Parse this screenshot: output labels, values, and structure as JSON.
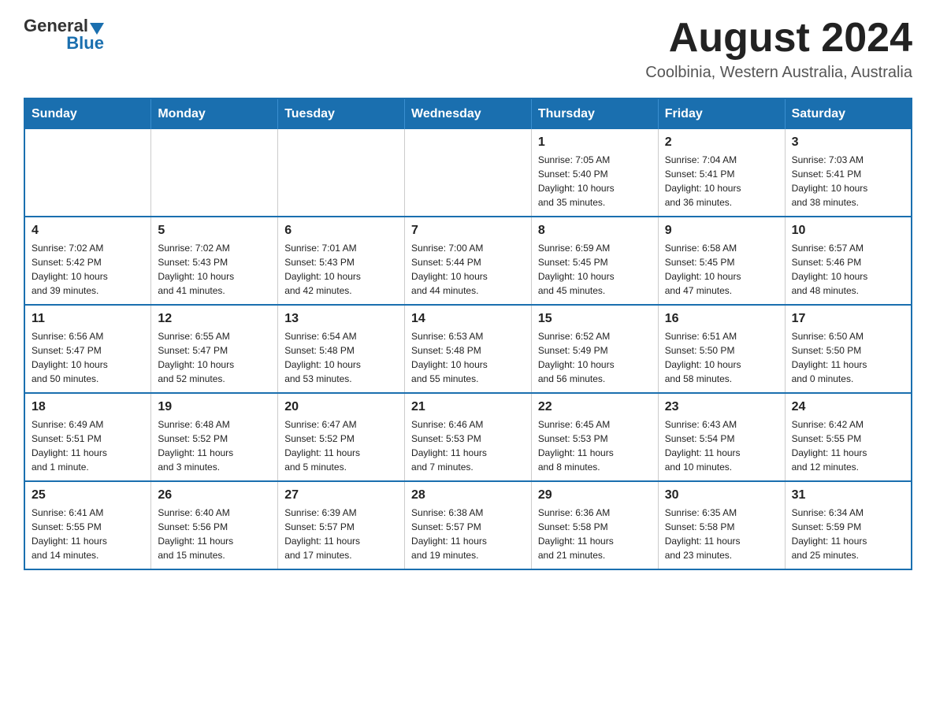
{
  "header": {
    "logo_general": "General",
    "logo_blue": "Blue",
    "month_title": "August 2024",
    "location": "Coolbinia, Western Australia, Australia"
  },
  "weekdays": [
    "Sunday",
    "Monday",
    "Tuesday",
    "Wednesday",
    "Thursday",
    "Friday",
    "Saturday"
  ],
  "weeks": [
    [
      {
        "day": "",
        "info": ""
      },
      {
        "day": "",
        "info": ""
      },
      {
        "day": "",
        "info": ""
      },
      {
        "day": "",
        "info": ""
      },
      {
        "day": "1",
        "info": "Sunrise: 7:05 AM\nSunset: 5:40 PM\nDaylight: 10 hours\nand 35 minutes."
      },
      {
        "day": "2",
        "info": "Sunrise: 7:04 AM\nSunset: 5:41 PM\nDaylight: 10 hours\nand 36 minutes."
      },
      {
        "day": "3",
        "info": "Sunrise: 7:03 AM\nSunset: 5:41 PM\nDaylight: 10 hours\nand 38 minutes."
      }
    ],
    [
      {
        "day": "4",
        "info": "Sunrise: 7:02 AM\nSunset: 5:42 PM\nDaylight: 10 hours\nand 39 minutes."
      },
      {
        "day": "5",
        "info": "Sunrise: 7:02 AM\nSunset: 5:43 PM\nDaylight: 10 hours\nand 41 minutes."
      },
      {
        "day": "6",
        "info": "Sunrise: 7:01 AM\nSunset: 5:43 PM\nDaylight: 10 hours\nand 42 minutes."
      },
      {
        "day": "7",
        "info": "Sunrise: 7:00 AM\nSunset: 5:44 PM\nDaylight: 10 hours\nand 44 minutes."
      },
      {
        "day": "8",
        "info": "Sunrise: 6:59 AM\nSunset: 5:45 PM\nDaylight: 10 hours\nand 45 minutes."
      },
      {
        "day": "9",
        "info": "Sunrise: 6:58 AM\nSunset: 5:45 PM\nDaylight: 10 hours\nand 47 minutes."
      },
      {
        "day": "10",
        "info": "Sunrise: 6:57 AM\nSunset: 5:46 PM\nDaylight: 10 hours\nand 48 minutes."
      }
    ],
    [
      {
        "day": "11",
        "info": "Sunrise: 6:56 AM\nSunset: 5:47 PM\nDaylight: 10 hours\nand 50 minutes."
      },
      {
        "day": "12",
        "info": "Sunrise: 6:55 AM\nSunset: 5:47 PM\nDaylight: 10 hours\nand 52 minutes."
      },
      {
        "day": "13",
        "info": "Sunrise: 6:54 AM\nSunset: 5:48 PM\nDaylight: 10 hours\nand 53 minutes."
      },
      {
        "day": "14",
        "info": "Sunrise: 6:53 AM\nSunset: 5:48 PM\nDaylight: 10 hours\nand 55 minutes."
      },
      {
        "day": "15",
        "info": "Sunrise: 6:52 AM\nSunset: 5:49 PM\nDaylight: 10 hours\nand 56 minutes."
      },
      {
        "day": "16",
        "info": "Sunrise: 6:51 AM\nSunset: 5:50 PM\nDaylight: 10 hours\nand 58 minutes."
      },
      {
        "day": "17",
        "info": "Sunrise: 6:50 AM\nSunset: 5:50 PM\nDaylight: 11 hours\nand 0 minutes."
      }
    ],
    [
      {
        "day": "18",
        "info": "Sunrise: 6:49 AM\nSunset: 5:51 PM\nDaylight: 11 hours\nand 1 minute."
      },
      {
        "day": "19",
        "info": "Sunrise: 6:48 AM\nSunset: 5:52 PM\nDaylight: 11 hours\nand 3 minutes."
      },
      {
        "day": "20",
        "info": "Sunrise: 6:47 AM\nSunset: 5:52 PM\nDaylight: 11 hours\nand 5 minutes."
      },
      {
        "day": "21",
        "info": "Sunrise: 6:46 AM\nSunset: 5:53 PM\nDaylight: 11 hours\nand 7 minutes."
      },
      {
        "day": "22",
        "info": "Sunrise: 6:45 AM\nSunset: 5:53 PM\nDaylight: 11 hours\nand 8 minutes."
      },
      {
        "day": "23",
        "info": "Sunrise: 6:43 AM\nSunset: 5:54 PM\nDaylight: 11 hours\nand 10 minutes."
      },
      {
        "day": "24",
        "info": "Sunrise: 6:42 AM\nSunset: 5:55 PM\nDaylight: 11 hours\nand 12 minutes."
      }
    ],
    [
      {
        "day": "25",
        "info": "Sunrise: 6:41 AM\nSunset: 5:55 PM\nDaylight: 11 hours\nand 14 minutes."
      },
      {
        "day": "26",
        "info": "Sunrise: 6:40 AM\nSunset: 5:56 PM\nDaylight: 11 hours\nand 15 minutes."
      },
      {
        "day": "27",
        "info": "Sunrise: 6:39 AM\nSunset: 5:57 PM\nDaylight: 11 hours\nand 17 minutes."
      },
      {
        "day": "28",
        "info": "Sunrise: 6:38 AM\nSunset: 5:57 PM\nDaylight: 11 hours\nand 19 minutes."
      },
      {
        "day": "29",
        "info": "Sunrise: 6:36 AM\nSunset: 5:58 PM\nDaylight: 11 hours\nand 21 minutes."
      },
      {
        "day": "30",
        "info": "Sunrise: 6:35 AM\nSunset: 5:58 PM\nDaylight: 11 hours\nand 23 minutes."
      },
      {
        "day": "31",
        "info": "Sunrise: 6:34 AM\nSunset: 5:59 PM\nDaylight: 11 hours\nand 25 minutes."
      }
    ]
  ]
}
